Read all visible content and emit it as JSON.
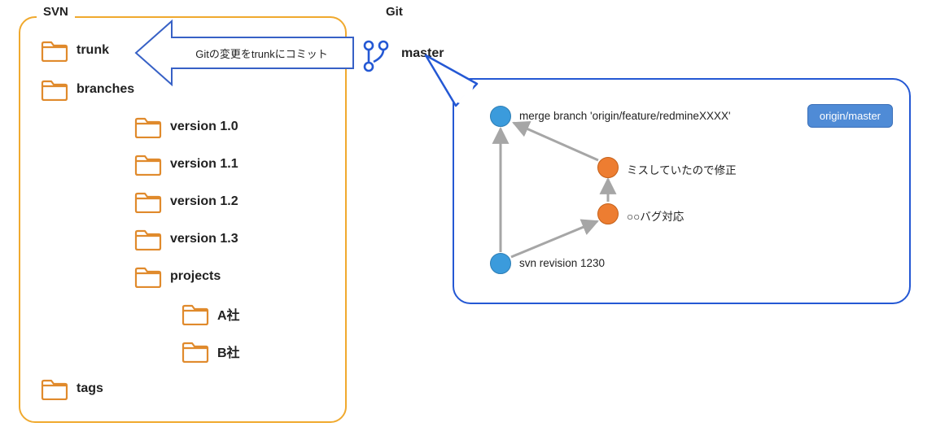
{
  "svn": {
    "title": "SVN",
    "nodes": {
      "trunk": "trunk",
      "branches": "branches",
      "v10": "version 1.0",
      "v11": "version 1.1",
      "v12": "version 1.2",
      "v13": "version 1.3",
      "projects": "projects",
      "companyA": "A社",
      "companyB": "B社",
      "tags": "tags"
    }
  },
  "arrow": {
    "label": "Gitの変更をtrunkにコミット"
  },
  "git": {
    "title": "Git",
    "master": "master"
  },
  "balloon": {
    "badge": "origin/master",
    "commits": {
      "merge": "merge branch 'origin/feature/redmineXXXX'",
      "fix": "ミスしていたので修正",
      "bug": "○○バグ対応",
      "svn": "svn revision 1230"
    }
  }
}
